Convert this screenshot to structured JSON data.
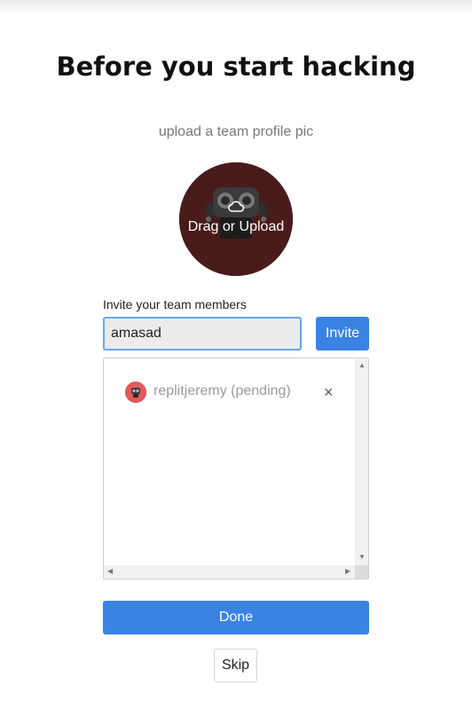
{
  "page": {
    "title": "Before you start hacking",
    "subtitle": "upload a team profile pic"
  },
  "upload": {
    "label": "Drag or Upload",
    "icon": "cloud-icon",
    "background_color": "#4a1b1b"
  },
  "invite": {
    "label": "Invite your team members",
    "input_value": "amasad",
    "button_label": "Invite"
  },
  "members": [
    {
      "name": "replitjeremy (pending)",
      "remove_label": "×",
      "avatar_color": "#e25a5a"
    }
  ],
  "actions": {
    "done_label": "Done",
    "skip_label": "Skip"
  },
  "colors": {
    "accent": "#3a83e3",
    "input_border": "#6aa6e6"
  }
}
